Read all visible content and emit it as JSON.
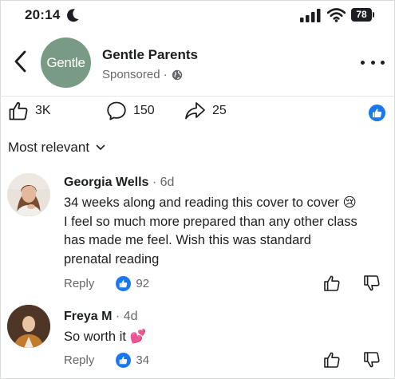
{
  "status_bar": {
    "time": "20:14",
    "battery": "78"
  },
  "header": {
    "page_name": "Gentle Parents",
    "avatar_text": "Gentle",
    "sponsored": "Sponsored ·"
  },
  "actions": {
    "likes": "3K",
    "comments": "150",
    "shares": "25"
  },
  "sort": {
    "label": "Most relevant"
  },
  "comments": [
    {
      "author": "Georgia Wells",
      "time": "6d",
      "lines": [
        "34 weeks along and reading this cover to cover 😢",
        "I feel so much more prepared than any other class",
        "has made me feel. Wish this was standard",
        "prenatal reading"
      ],
      "reply_label": "Reply",
      "like_count": "92"
    },
    {
      "author": "Freya M",
      "time": "4d",
      "lines": [
        "So worth it 💕"
      ],
      "reply_label": "Reply",
      "like_count": "34"
    }
  ],
  "colors": {
    "accent": "#1877f2",
    "avatar_bg": "#799b85",
    "muted_text": "#65676b"
  },
  "icons": [
    "moon-icon",
    "signal-icon",
    "wifi-icon",
    "back-chevron-icon",
    "globe-icon",
    "more-dots-icon",
    "like-icon",
    "comment-icon",
    "share-icon",
    "chevron-down-icon",
    "thumbs-up-icon",
    "thumbs-down-icon"
  ]
}
